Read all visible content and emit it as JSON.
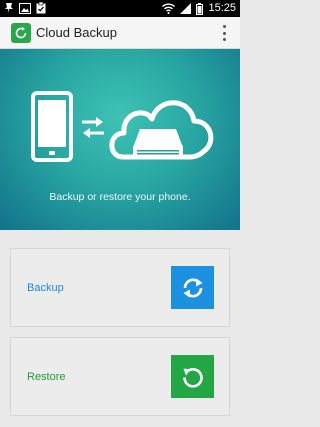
{
  "status_bar": {
    "time": "15:25",
    "left_icons": [
      "pin-icon",
      "image-icon",
      "clipboard-icon"
    ],
    "right_icons": [
      "wifi-icon",
      "signal-icon",
      "battery-icon"
    ]
  },
  "app_bar": {
    "title": "Cloud Backup",
    "logo_icon": "cloud-backup-logo-icon",
    "menu_icon": "overflow-menu-icon"
  },
  "hero": {
    "tagline": "Backup or restore your phone.",
    "illustration": [
      "phone-icon",
      "sync-arrows-icon",
      "cloud-drive-icon"
    ]
  },
  "actions": [
    {
      "label": "Backup",
      "icon": "backup-icon",
      "color": "#1e90e0"
    },
    {
      "label": "Restore",
      "icon": "restore-icon",
      "color": "#23a645"
    }
  ],
  "colors": {
    "hero_gradient": [
      "#3fc2b4",
      "#12728a"
    ],
    "backup_accent": "#1e88d6",
    "restore_accent": "#1f9a3f"
  }
}
